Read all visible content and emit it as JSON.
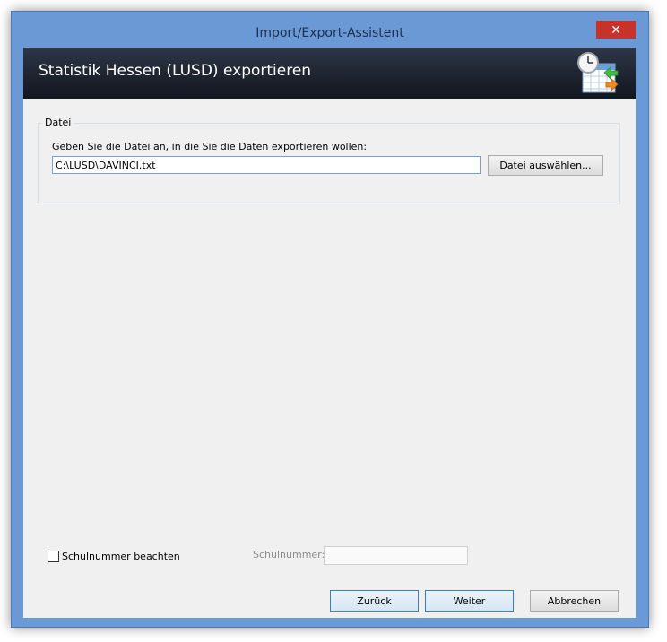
{
  "window": {
    "title": "Import/Export-Assistent",
    "close_glyph": "✕"
  },
  "banner": {
    "title": "Statistik Hessen (LUSD) exportieren",
    "icon": "calendar-clock-export-icon"
  },
  "file_group": {
    "legend": "Datei",
    "prompt": "Geben Sie die Datei an, in die Sie die Daten exportieren wollen:",
    "path_value": "C:\\LUSD\\DAVINCI.txt",
    "choose_label": "Datei auswählen..."
  },
  "options": {
    "checkbox_label": "Schulnummer beachten",
    "checkbox_checked": false,
    "schulnummer_label": "Schulnummer:",
    "schulnummer_value": ""
  },
  "buttons": {
    "back": "Zurück",
    "next": "Weiter",
    "cancel": "Abbrechen"
  },
  "colors": {
    "frame": "#6b99d6",
    "close": "#c7332b",
    "banner": "#1e2430"
  }
}
